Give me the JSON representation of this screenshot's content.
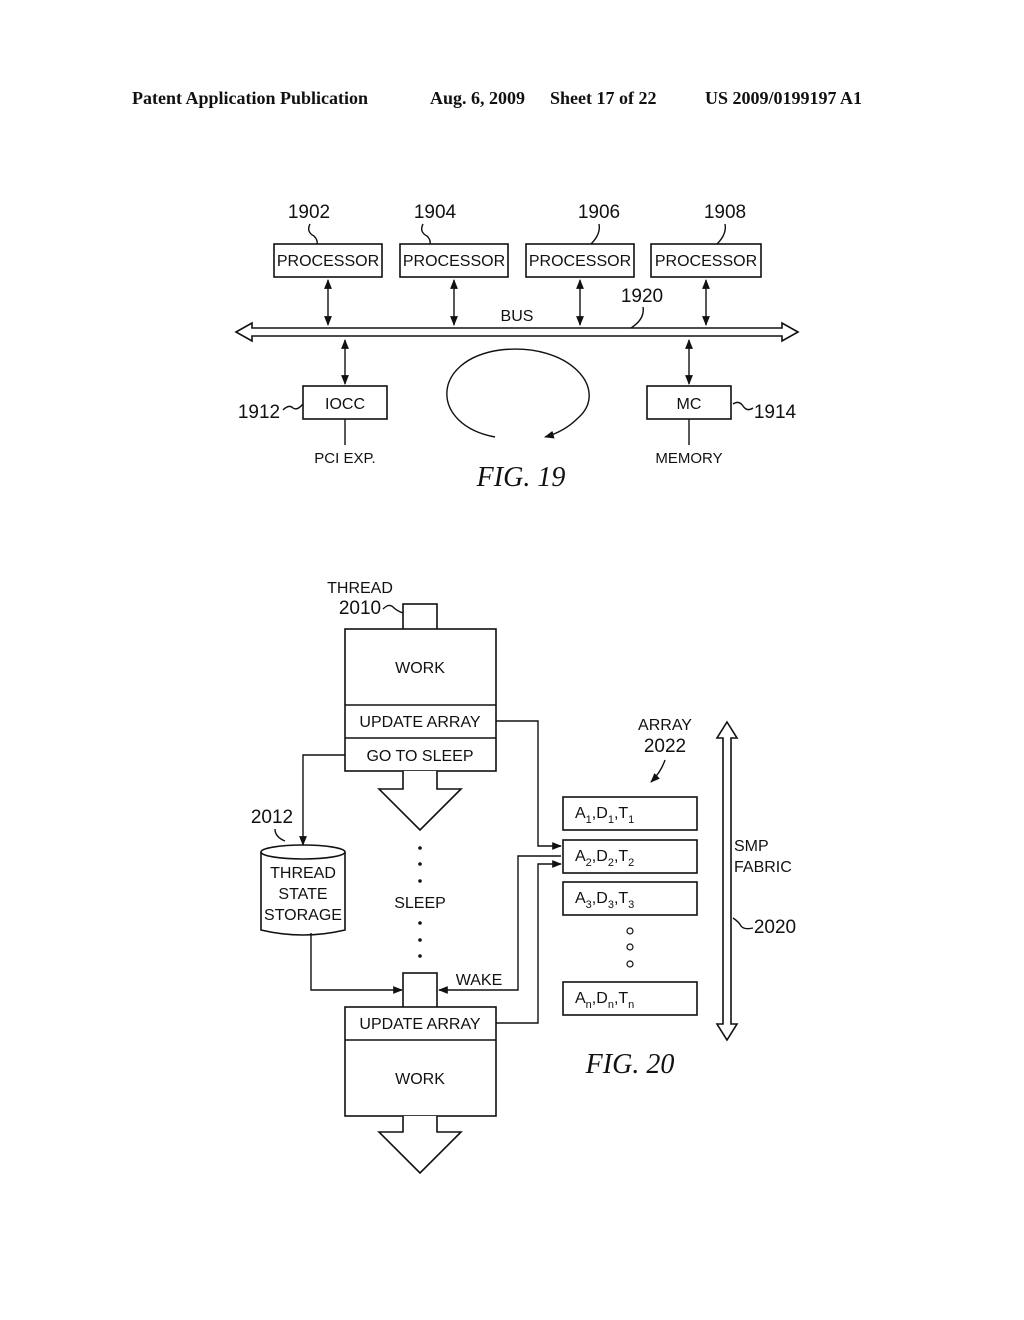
{
  "header": {
    "publication": "Patent Application Publication",
    "date": "Aug. 6, 2009",
    "sheet": "Sheet 17 of 22",
    "number": "US 2009/0199197 A1"
  },
  "fig19": {
    "caption": "FIG. 19",
    "processors": [
      {
        "ref": "1902",
        "label": "PROCESSOR"
      },
      {
        "ref": "1904",
        "label": "PROCESSOR"
      },
      {
        "ref": "1906",
        "label": "PROCESSOR"
      },
      {
        "ref": "1908",
        "label": "PROCESSOR"
      }
    ],
    "bus": {
      "label": "BUS",
      "ref": "1920"
    },
    "iocc": {
      "label": "IOCC",
      "ref": "1912",
      "below": "PCI EXP."
    },
    "mc": {
      "label": "MC",
      "ref": "1914",
      "below": "MEMORY"
    }
  },
  "fig20": {
    "caption": "FIG. 20",
    "thread": {
      "label": "THREAD",
      "ref": "2010"
    },
    "top_block": {
      "work": "WORK",
      "update": "UPDATE ARRAY",
      "sleep": "GO TO SLEEP"
    },
    "sleep_label": "SLEEP",
    "wake_label": "WAKE",
    "bottom_block": {
      "update": "UPDATE ARRAY",
      "work": "WORK"
    },
    "storage": {
      "ref": "2012",
      "lines": [
        "THREAD",
        "STATE",
        "STORAGE"
      ]
    },
    "array": {
      "label": "ARRAY",
      "ref": "2022",
      "entries": [
        {
          "a": "A",
          "d": "D",
          "t": "T",
          "sub": "1"
        },
        {
          "a": "A",
          "d": "D",
          "t": "T",
          "sub": "2"
        },
        {
          "a": "A",
          "d": "D",
          "t": "T",
          "sub": "3"
        },
        {
          "a": "A",
          "d": "D",
          "t": "T",
          "sub": "n"
        }
      ]
    },
    "fabric": {
      "lines": [
        "SMP",
        "FABRIC"
      ],
      "ref": "2020"
    }
  }
}
